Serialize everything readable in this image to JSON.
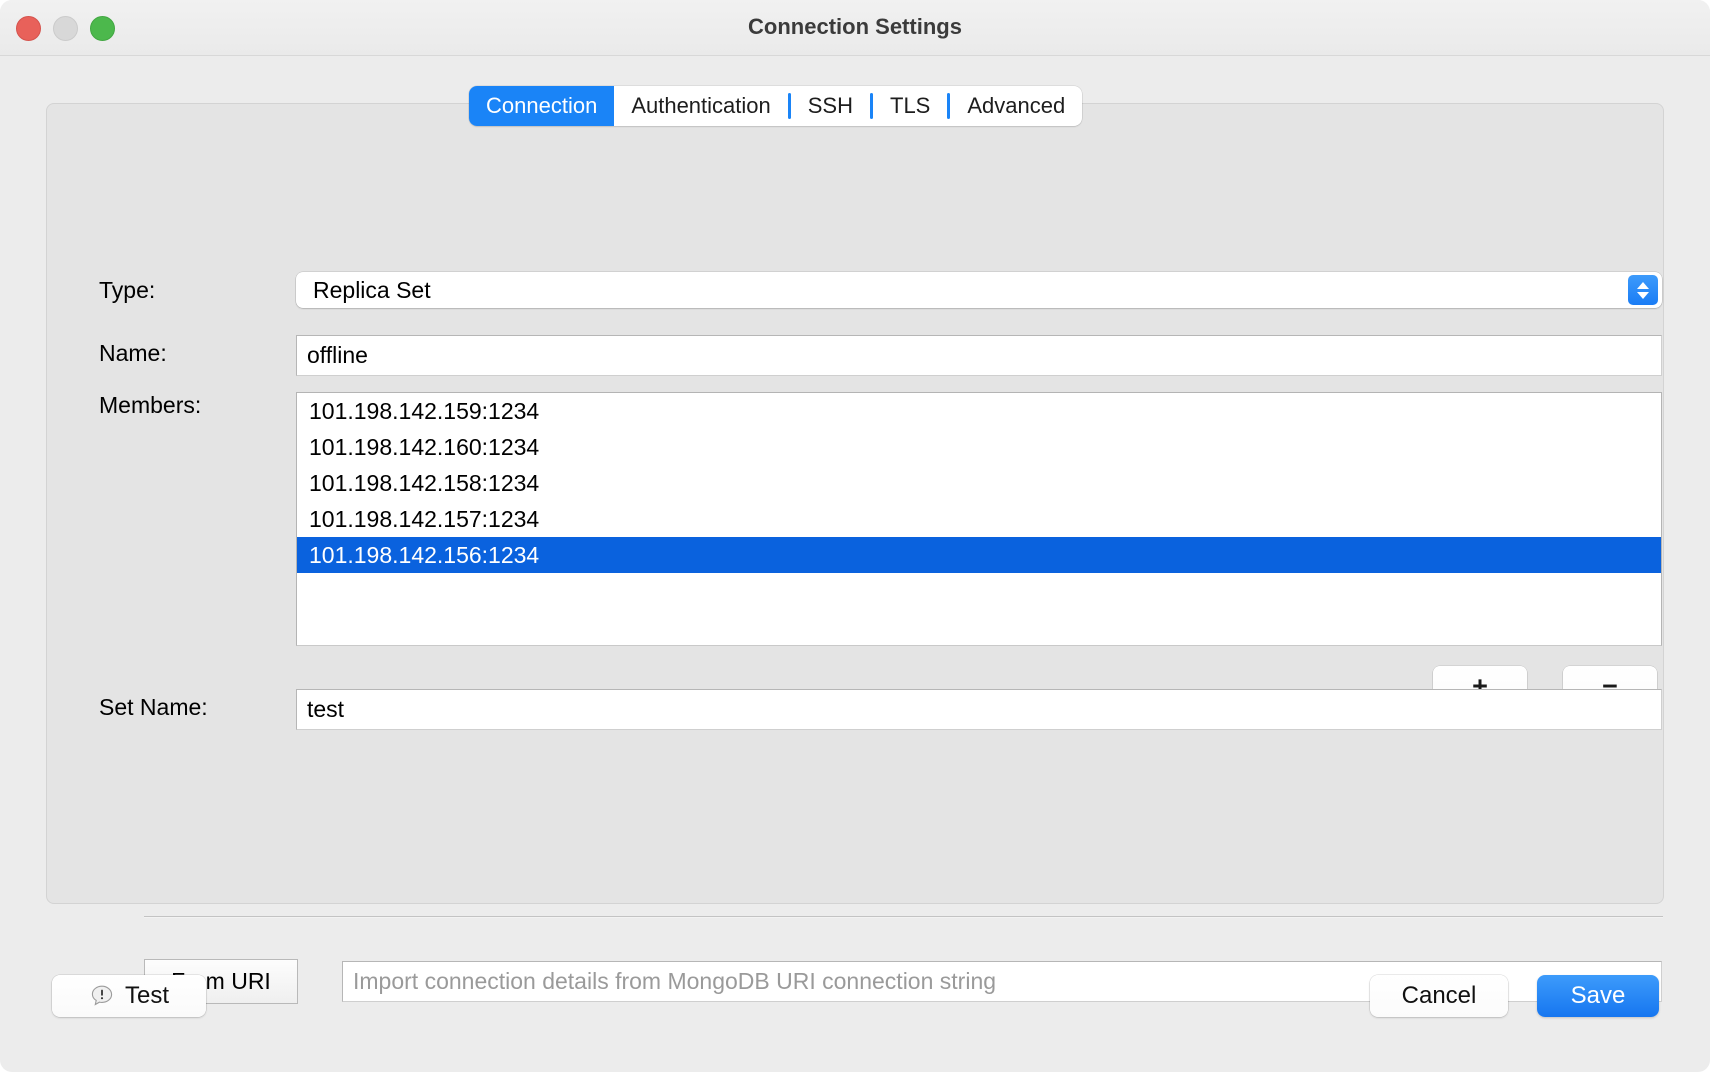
{
  "window": {
    "title": "Connection Settings",
    "traffic_lights": [
      {
        "name": "close",
        "color": "#e8615a"
      },
      {
        "name": "minimize",
        "color": "#d8d8d8"
      },
      {
        "name": "zoom",
        "color": "#4cb84c"
      }
    ]
  },
  "tabs": {
    "items": [
      {
        "label": "Connection",
        "selected": true
      },
      {
        "label": "Authentication",
        "selected": false
      },
      {
        "label": "SSH",
        "selected": false
      },
      {
        "label": "TLS",
        "selected": false
      },
      {
        "label": "Advanced",
        "selected": false
      }
    ],
    "selected_color": "#1a84f7"
  },
  "form": {
    "type": {
      "label": "Type:",
      "value": "Replica Set",
      "stepper_icon": "chevron-up-down-icon"
    },
    "name": {
      "label": "Name:",
      "value": "offline"
    },
    "members": {
      "label": "Members:",
      "items": [
        "101.198.142.159:1234",
        "101.198.142.160:1234",
        "101.198.142.158:1234",
        "101.198.142.157:1234",
        "101.198.142.156:1234"
      ],
      "selected_index": 4,
      "selection_color": "#0a62de",
      "add_label": "+",
      "remove_label": "−"
    },
    "set_name": {
      "label": "Set Name:",
      "value": "test"
    }
  },
  "from_uri": {
    "button_label": "From URI",
    "placeholder": "Import connection details from MongoDB URI connection string",
    "value": ""
  },
  "footer": {
    "test_label": "Test",
    "test_icon": "alert-bubble-icon",
    "cancel_label": "Cancel",
    "save_label": "Save",
    "save_color": "#1676f0"
  }
}
